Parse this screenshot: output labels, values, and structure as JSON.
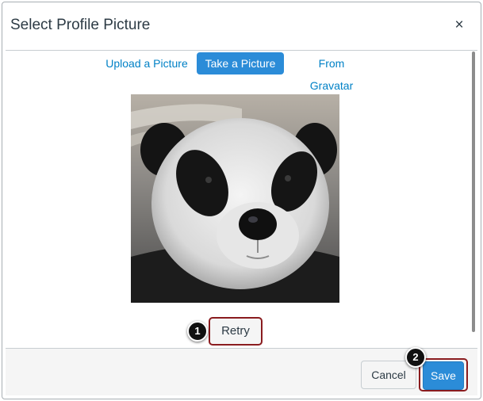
{
  "dialog": {
    "title": "Select Profile Picture",
    "close_label": "×"
  },
  "tabs": [
    {
      "label": "Upload a Picture",
      "active": false
    },
    {
      "label": "Take a Picture",
      "active": true
    },
    {
      "label": "From Gravatar",
      "active": false
    }
  ],
  "photo": {
    "icon": "panda-photo"
  },
  "actions": {
    "retry_label": "Retry",
    "cancel_label": "Cancel",
    "save_label": "Save"
  },
  "callouts": {
    "one": "1",
    "two": "2"
  },
  "colors": {
    "accent": "#2b8cd8",
    "link": "#0081c6",
    "highlight_border": "#8a1c1f"
  }
}
